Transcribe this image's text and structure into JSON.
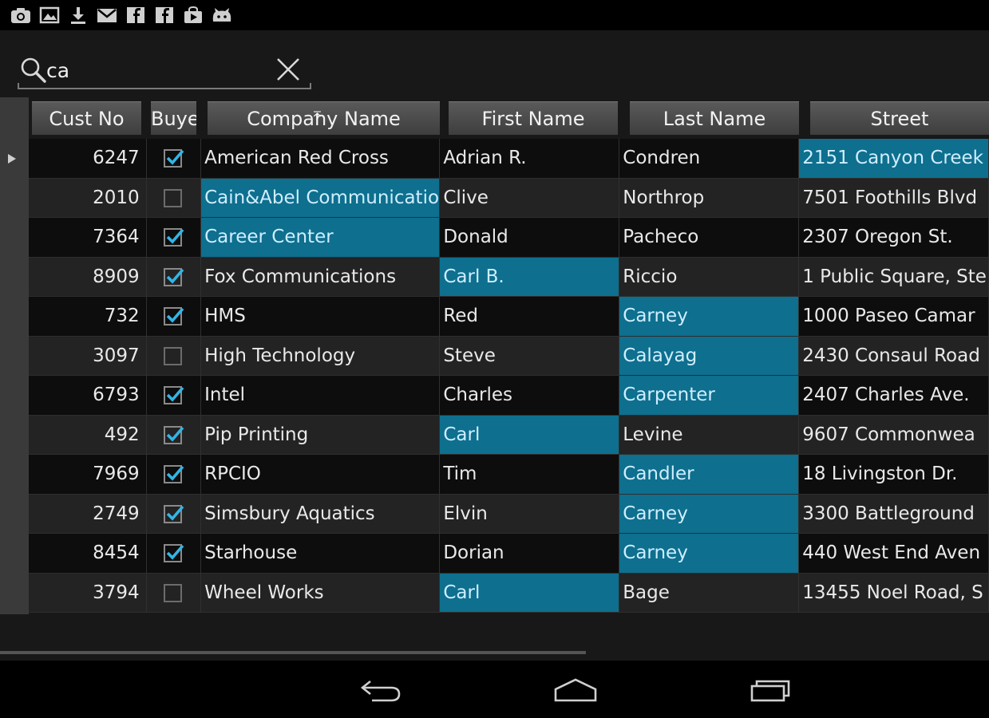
{
  "status_bar": {
    "icons": [
      "camera-icon",
      "image-icon",
      "download-icon",
      "gmail-icon",
      "facebook-icon",
      "facebook-icon",
      "youtube-bag-icon",
      "cat-icon"
    ]
  },
  "search": {
    "value": "ca",
    "icon": "search-icon",
    "clear_icon": "close-icon"
  },
  "grid": {
    "columns": [
      {
        "key": "cust_no",
        "label": "Cust No"
      },
      {
        "key": "buyer",
        "label": "Buyer"
      },
      {
        "key": "company",
        "label": "Company Name",
        "sort": "ascending"
      },
      {
        "key": "first",
        "label": "First Name"
      },
      {
        "key": "last",
        "label": "Last Name"
      },
      {
        "key": "street",
        "label": "Street"
      }
    ],
    "sort_icon": "sort-arrow-icon",
    "highlight_color": "#0e6f8e",
    "rows": [
      {
        "cust_no": "6247",
        "buyer": true,
        "company": "American Red Cross",
        "first": "Adrian R.",
        "last": "Condren",
        "street": "2151 Canyon Creek",
        "hl": [
          "street"
        ]
      },
      {
        "cust_no": "2010",
        "buyer": false,
        "company": "Cain&Abel Communications",
        "first": "Clive",
        "last": "Northrop",
        "street": "7501 Foothills Blvd",
        "hl": [
          "company"
        ]
      },
      {
        "cust_no": "7364",
        "buyer": true,
        "company": "Career Center",
        "first": "Donald",
        "last": "Pacheco",
        "street": "2307 Oregon St.",
        "hl": [
          "company"
        ]
      },
      {
        "cust_no": "8909",
        "buyer": true,
        "company": "Fox Communications",
        "first": "Carl B.",
        "last": "Riccio",
        "street": "1 Public Square, Ste",
        "hl": [
          "first"
        ]
      },
      {
        "cust_no": "732",
        "buyer": true,
        "company": "HMS",
        "first": "Red",
        "last": "Carney",
        "street": "1000 Paseo Camar",
        "hl": [
          "last"
        ]
      },
      {
        "cust_no": "3097",
        "buyer": false,
        "company": "High Technology",
        "first": "Steve",
        "last": "Calayag",
        "street": "2430 Consaul Road",
        "hl": [
          "last"
        ]
      },
      {
        "cust_no": "6793",
        "buyer": true,
        "company": "Intel",
        "first": "Charles",
        "last": "Carpenter",
        "street": "2407 Charles Ave.",
        "hl": [
          "last"
        ]
      },
      {
        "cust_no": "492",
        "buyer": true,
        "company": "Pip Printing",
        "first": "Carl",
        "last": "Levine",
        "street": "9607 Commonwea",
        "hl": [
          "first"
        ]
      },
      {
        "cust_no": "7969",
        "buyer": true,
        "company": "RPCIO",
        "first": "Tim",
        "last": "Candler",
        "street": "18 Livingston Dr.",
        "hl": [
          "last"
        ]
      },
      {
        "cust_no": "2749",
        "buyer": true,
        "company": "Simsbury Aquatics",
        "first": "Elvin",
        "last": "Carney",
        "street": "3300 Battleground",
        "hl": [
          "last"
        ]
      },
      {
        "cust_no": "8454",
        "buyer": true,
        "company": "Starhouse",
        "first": "Dorian",
        "last": "Carney",
        "street": "440 West End Aven",
        "hl": [
          "last"
        ]
      },
      {
        "cust_no": "3794",
        "buyer": false,
        "company": "Wheel Works",
        "first": "Carl",
        "last": "Bage",
        "street": "13455 Noel Road, S",
        "hl": [
          "first"
        ]
      }
    ]
  },
  "nav_bar": {
    "buttons": [
      "back-icon",
      "home-icon",
      "recent-apps-icon"
    ]
  }
}
